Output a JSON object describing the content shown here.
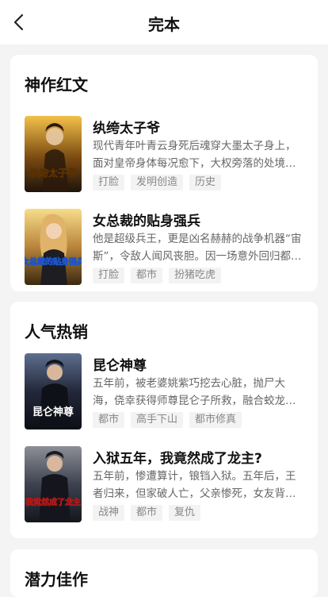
{
  "header": {
    "title": "完本"
  },
  "sections": [
    {
      "title": "神作红文",
      "books": [
        {
          "title": "纨绔太子爷",
          "desc": "现代青年叶青云身死后魂穿大墨太子身上，面对皇帝身体每况愈下，大权旁落的处境，被迫扮演纨绔太子……",
          "tags": [
            "打脸",
            "发明创造",
            "历史"
          ],
          "cover_text": "纨绔太子爷",
          "colors": [
            "#f3c14a",
            "#7a4a12",
            "#1e140b"
          ]
        },
        {
          "title": "女总裁的贴身强兵",
          "desc": "他是超级兵王，更是凶名赫赫的战争机器“宙斯”，令敌人闻风丧胆。因一场意外回归都市，成为女总裁的贴身保镖……",
          "tags": [
            "打脸",
            "都市",
            "扮猪吃虎"
          ],
          "cover_text": "女总裁的贴身强兵",
          "colors": [
            "#f7dd8a",
            "#b9853b",
            "#3b2a10"
          ]
        }
      ]
    },
    {
      "title": "人气热销",
      "books": [
        {
          "title": "昆仑神尊",
          "desc": "五年前，被老婆姚紫巧挖去心脏，抛尸大海，侥幸获得师尊昆仑子所救，融合蛟龙之心……",
          "tags": [
            "都市",
            "高手下山",
            "都市修真"
          ],
          "cover_text": "昆仑神尊",
          "colors": [
            "#5d6f8f",
            "#23283a",
            "#0c0e16"
          ]
        },
        {
          "title": "入狱五年，我竟然成了龙主?",
          "desc": "五年前，惨遭算计，锒铛入狱。五年后，王者归来，但家破人亡，父亲惨死，女友背叛……",
          "tags": [
            "战神",
            "都市",
            "复仇"
          ],
          "cover_text": "我竟然成了龙主",
          "colors": [
            "#8d8f97",
            "#3e4250",
            "#14161d"
          ]
        }
      ]
    },
    {
      "title": "潜力佳作",
      "books": []
    }
  ]
}
